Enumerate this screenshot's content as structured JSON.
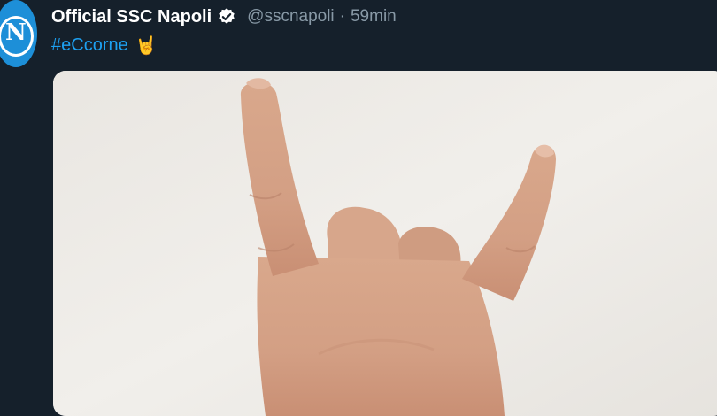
{
  "tweet": {
    "avatar_icon": "ssc-napoli-logo-icon",
    "avatar_letter": "N",
    "display_name": "Official SSC Napoli",
    "verified_icon": "verified-badge-icon",
    "handle": "@sscnapoli",
    "separator": "·",
    "timestamp": "59min",
    "hashtag": "#eCcorne",
    "emoji": "🤘",
    "media_icon": "hand-horns-photo"
  },
  "colors": {
    "background": "#15202b",
    "text_primary": "#ffffff",
    "text_secondary": "#8899a6",
    "link": "#1da1f2",
    "verified": "#ffffff"
  }
}
